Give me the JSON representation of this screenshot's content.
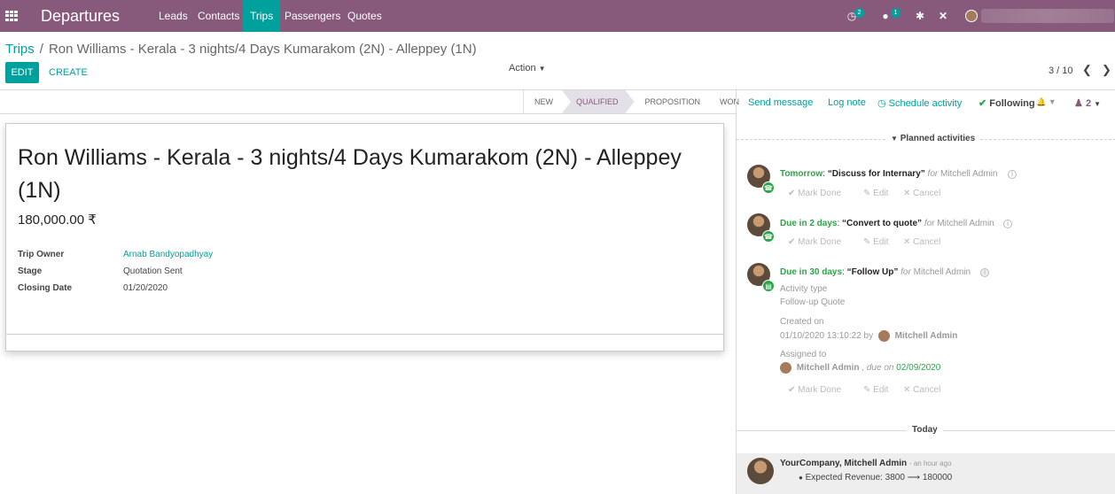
{
  "navbar": {
    "brand": "Departures",
    "menu": [
      "Leads",
      "Contacts",
      "Trips",
      "Passengers",
      "Quotes"
    ],
    "active_menu": "Trips",
    "activity_count": "2",
    "message_count": "1",
    "bug_icon": "bug-icon",
    "tools_icon": "tools-icon",
    "accent_color": "#875A7B",
    "active_color": "#00A09D"
  },
  "control": {
    "breadcrumb_root": "Trips",
    "breadcrumb_sep": "/",
    "breadcrumb_current": "Ron Williams - Kerala - 3 nights/4 Days Kumarakom (2N) - Alleppey (1N)",
    "edit_label": "EDIT",
    "create_label": "CREATE",
    "action_label": "Action",
    "pager": "3 / 10"
  },
  "statusbar": {
    "stages": [
      "NEW",
      "QUALIFIED",
      "PROPOSITION",
      "WON"
    ],
    "current": "QUALIFIED"
  },
  "record": {
    "title": "Ron Williams - Kerala - 3 nights/4 Days Kumarakom (2N) - Alleppey (1N)",
    "amount": "180,000.00 ₹",
    "fields": [
      {
        "label": "Trip Owner",
        "value": "Arnab Bandyopadhyay"
      },
      {
        "label": "Stage",
        "value": "Quotation Sent"
      },
      {
        "label": "Closing Date",
        "value": "01/20/2020"
      }
    ]
  },
  "chatter": {
    "send_message": "Send message",
    "log_note": "Log note",
    "schedule_activity": "Schedule activity",
    "following": "Following",
    "followers_count": "2",
    "planned_activities": "Planned activities",
    "activities": [
      {
        "when": "Tomorrow",
        "what": "“Discuss for Internary”",
        "for": "for",
        "user": "Mitchell Admin",
        "icon": "phone-icon"
      },
      {
        "when": "Due in 2 days",
        "what": "“Convert to quote”",
        "for": "for",
        "user": "Mitchell Admin",
        "icon": "phone-icon"
      },
      {
        "when": "Due in 30 days",
        "what": "“Follow Up”",
        "for": "for",
        "user": "Mitchell Admin",
        "icon": "document-icon"
      }
    ],
    "mark_done": "Mark Done",
    "edit": "Edit",
    "cancel": "Cancel",
    "detail": {
      "activity_type_label": "Activity type",
      "activity_type": "Follow-up Quote",
      "created_on_label": "Created on",
      "created_on": "01/10/2020 13:10:22 by",
      "created_by": "Mitchell Admin",
      "assigned_to_label": "Assigned to",
      "assigned_to": "Mitchell Admin",
      "due_on_text": ", due on",
      "due_date": "02/09/2020"
    },
    "today_label": "Today",
    "message": {
      "author": "YourCompany, Mitchell Admin",
      "time": "- an hour ago",
      "tracking": "Expected Revenue: 3800 ⟶ 180000"
    }
  }
}
